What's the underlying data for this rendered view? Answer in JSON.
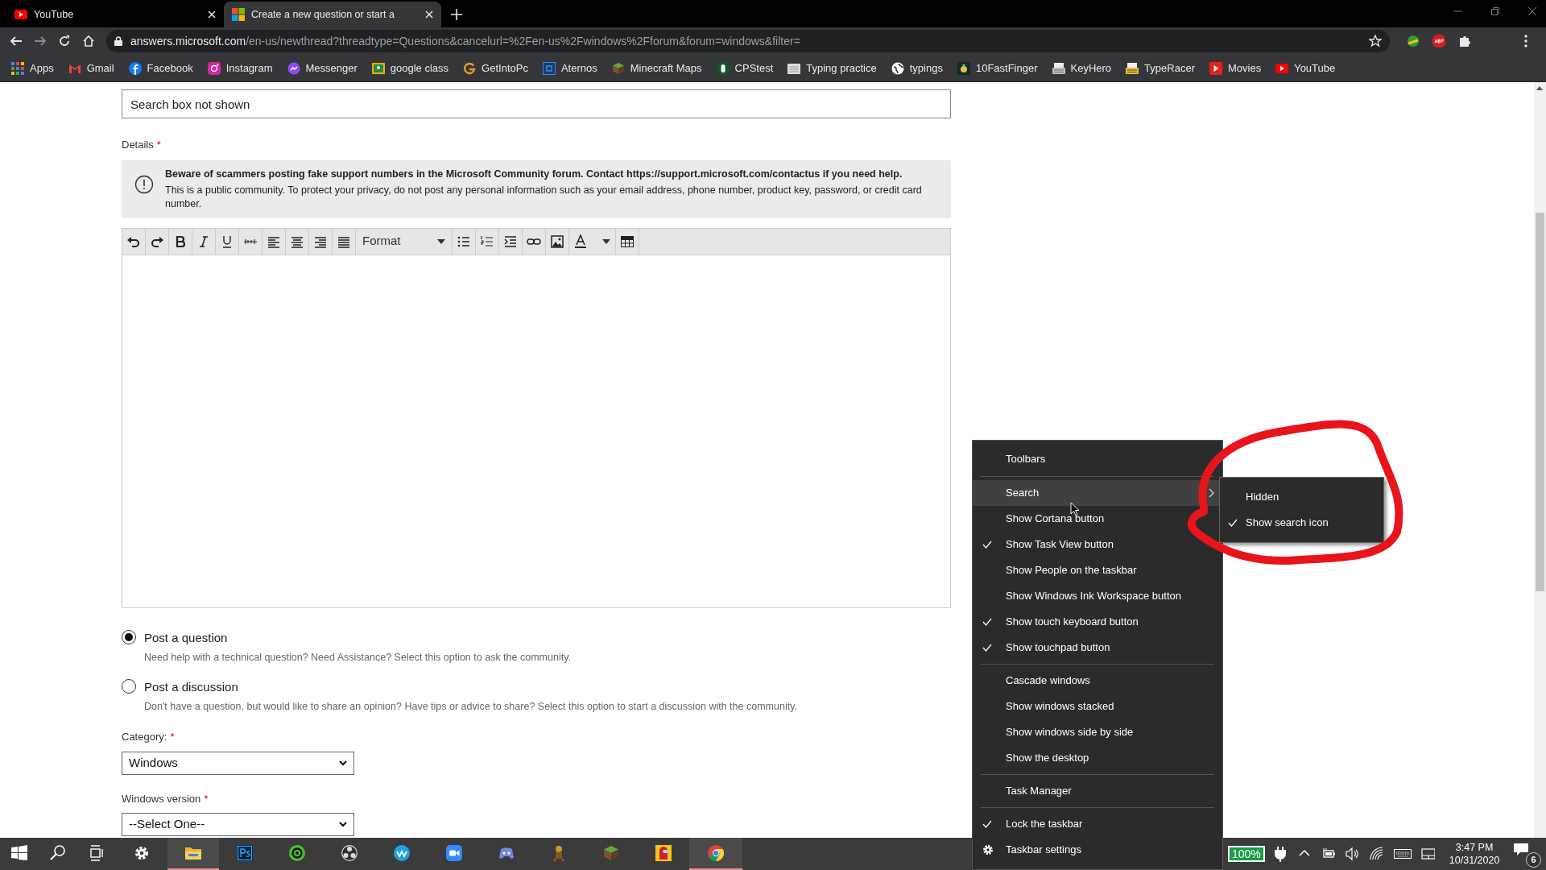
{
  "browser": {
    "tabs": [
      {
        "title": "YouTube",
        "selected": false
      },
      {
        "title": "Create a new question or start a",
        "selected": true
      }
    ],
    "url": {
      "host": "answers.microsoft.com",
      "path": "/en-us/newthread?threadtype=Questions&cancelurl=%2Fen-us%2Fwindows%2Fforum&forum=windows&filter="
    },
    "bookmarks": [
      {
        "label": "Apps"
      },
      {
        "label": "Gmail"
      },
      {
        "label": "Facebook"
      },
      {
        "label": "Instagram"
      },
      {
        "label": "Messenger"
      },
      {
        "label": "google class"
      },
      {
        "label": "GetIntoPc"
      },
      {
        "label": "Aternos"
      },
      {
        "label": "Minecraft Maps"
      },
      {
        "label": "CPStest"
      },
      {
        "label": "Typing practice"
      },
      {
        "label": "typings"
      },
      {
        "label": "10FastFinger"
      },
      {
        "label": "KeyHero"
      },
      {
        "label": "TypeRacer"
      },
      {
        "label": "Movies"
      },
      {
        "label": "YouTube"
      }
    ]
  },
  "form": {
    "title_value": "Search box not shown",
    "details_label": "Details",
    "required_mark": "*",
    "notice": {
      "bold": "Beware of scammers posting fake support numbers in the Microsoft Community forum. Contact https://support.microsoft.com/contactus if you need help.",
      "body": "This is a public community. To protect your privacy, do not post any personal information such as your email address, phone number, product key, password, or credit card number."
    },
    "toolbar": {
      "format": "Format"
    },
    "post_types": [
      {
        "label": "Post a question",
        "description": "Need help with a technical question? Need Assistance? Select this option to ask the community.",
        "selected": true
      },
      {
        "label": "Post a discussion",
        "description": "Don't have a question, but would like to share an opinion? Have tips or advice to share? Select this option to start a discussion with the community.",
        "selected": false
      }
    ],
    "category": {
      "label": "Category:",
      "value": "Windows"
    },
    "version": {
      "label": "Windows version",
      "value": "--Select One--"
    }
  },
  "context_menu": {
    "items": [
      {
        "kind": "item",
        "label": "Toolbars",
        "checked": false,
        "selected": false
      },
      {
        "kind": "separator"
      },
      {
        "kind": "submenu",
        "label": "Search",
        "checked": false,
        "selected": true
      },
      {
        "kind": "item",
        "label": "Show Cortana button",
        "checked": false,
        "selected": false
      },
      {
        "kind": "item",
        "label": "Show Task View button",
        "checked": true,
        "selected": false
      },
      {
        "kind": "item",
        "label": "Show People on the taskbar",
        "checked": false,
        "selected": false
      },
      {
        "kind": "item",
        "label": "Show Windows Ink Workspace button",
        "checked": false,
        "selected": false
      },
      {
        "kind": "item",
        "label": "Show touch keyboard button",
        "checked": true,
        "selected": false
      },
      {
        "kind": "item",
        "label": "Show touchpad button",
        "checked": true,
        "selected": false
      },
      {
        "kind": "separator"
      },
      {
        "kind": "item",
        "label": "Cascade windows",
        "checked": false,
        "selected": false
      },
      {
        "kind": "item",
        "label": "Show windows stacked",
        "checked": false,
        "selected": false
      },
      {
        "kind": "item",
        "label": "Show windows side by side",
        "checked": false,
        "selected": false
      },
      {
        "kind": "item",
        "label": "Show the desktop",
        "checked": false,
        "selected": false
      },
      {
        "kind": "separator"
      },
      {
        "kind": "item",
        "label": "Task Manager",
        "checked": false,
        "selected": false
      },
      {
        "kind": "separator"
      },
      {
        "kind": "item",
        "label": "Lock the taskbar",
        "checked": true,
        "selected": false
      },
      {
        "kind": "settings",
        "label": "Taskbar settings",
        "selected": false
      }
    ],
    "submenu": [
      {
        "label": "Hidden",
        "checked": false
      },
      {
        "label": "Show search icon",
        "checked": true
      }
    ]
  },
  "taskbar": {
    "apps": [
      {
        "active": false
      },
      {
        "active": false
      },
      {
        "active": false
      },
      {
        "active": false
      },
      {
        "active": true
      },
      {
        "active": false
      },
      {
        "active": false
      },
      {
        "active": false
      },
      {
        "active": false
      },
      {
        "active": false
      },
      {
        "active": false
      },
      {
        "active": false
      },
      {
        "active": false
      },
      {
        "active": false
      },
      {
        "active": true
      }
    ],
    "battery": "100%",
    "time": "3:47 PM",
    "date": "10/31/2020",
    "notifications": "6"
  }
}
